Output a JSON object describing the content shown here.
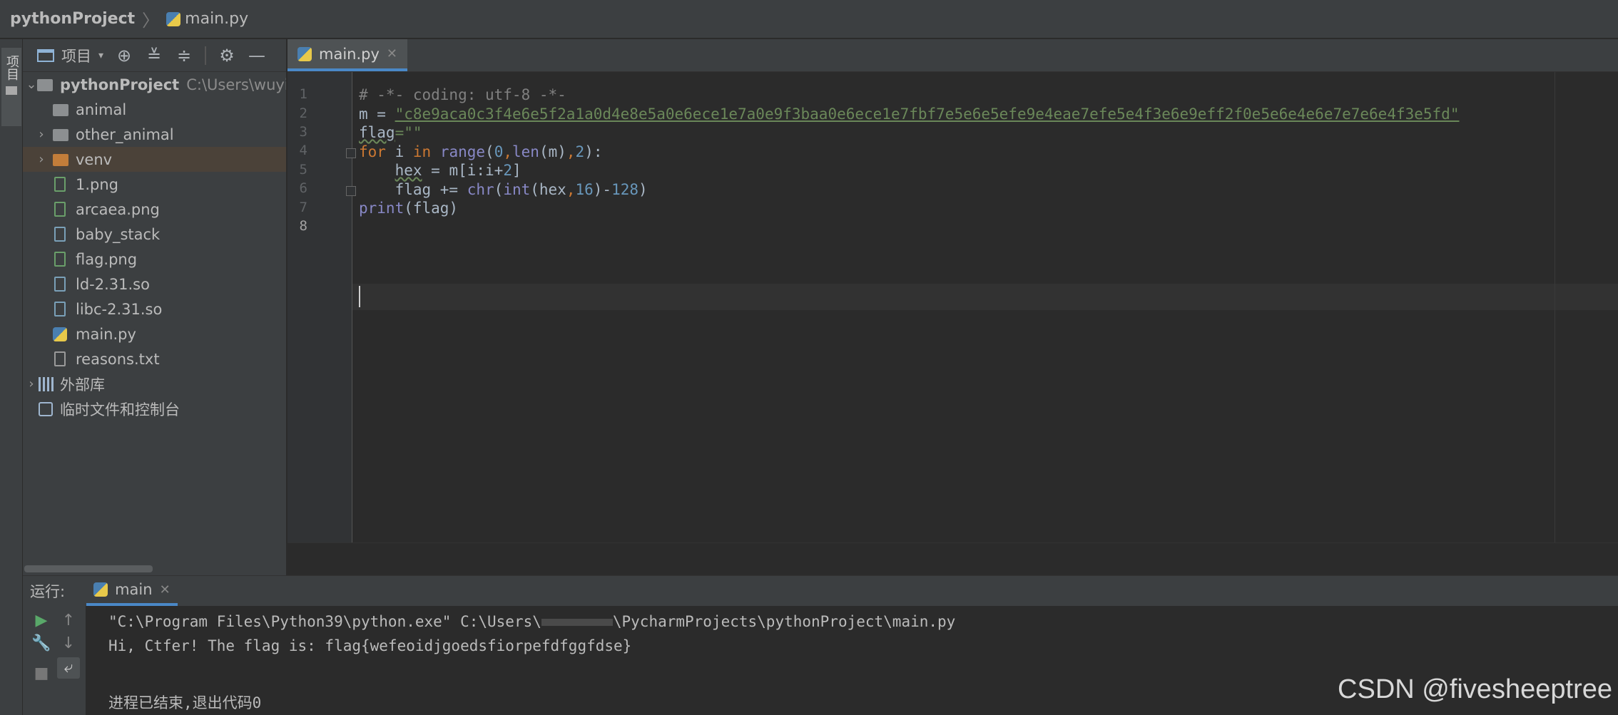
{
  "breadcrumb": {
    "project": "pythonProject",
    "file": "main.py"
  },
  "left_strip": {
    "tab_label": "项目"
  },
  "project_panel": {
    "title": "项目",
    "tree": [
      {
        "label": "pythonProject",
        "path": "C:\\Users\\wuyi",
        "kind": "project-folder",
        "expanded": true
      },
      {
        "label": "animal",
        "kind": "folder"
      },
      {
        "label": "other_animal",
        "kind": "folder",
        "collapsed": true
      },
      {
        "label": "venv",
        "kind": "folder-excluded",
        "collapsed": true,
        "selected": true
      },
      {
        "label": "1.png",
        "kind": "image"
      },
      {
        "label": "arcaea.png",
        "kind": "image"
      },
      {
        "label": "baby_stack",
        "kind": "unknown"
      },
      {
        "label": "flag.png",
        "kind": "image"
      },
      {
        "label": "ld-2.31.so",
        "kind": "unknown"
      },
      {
        "label": "libc-2.31.so",
        "kind": "unknown"
      },
      {
        "label": "main.py",
        "kind": "python"
      },
      {
        "label": "reasons.txt",
        "kind": "text"
      },
      {
        "label": "外部库",
        "kind": "library",
        "collapsed": true
      },
      {
        "label": "临时文件和控制台",
        "kind": "scratches"
      }
    ]
  },
  "editor": {
    "tab": "main.py",
    "line_numbers": [
      "1",
      "2",
      "3",
      "4",
      "5",
      "6",
      "7",
      "8"
    ],
    "lines": {
      "l1": "# -*- coding: utf-8 -*-",
      "l2_a": "m = ",
      "l2_str": "\"c8e9aca0c3f4e6e5f2a1a0d4e8e5a0e6ece1e7a0e9f3baa0e6ece1e7fbf7e5e6e5efe9e4eae7efe5e4f3e6e9eff2f0e5e6e4e6e7e7e6e4f3e5fd\"",
      "l3_a": "flag",
      "l3_b": "=\"\"",
      "l4_kw": "for",
      "l4_a": " i ",
      "l4_in": "in",
      "l4_sp": " ",
      "l4_range": "range",
      "l4_b": "(",
      "l4_0": "0",
      "l4_hint1": ",",
      "l4_len": "len",
      "l4_c": "(m)",
      "l4_hint2": ",",
      "l4_2": "2",
      "l4_d": "):",
      "l5_a": "    ",
      "l5_hex": "hex",
      "l5_b": " = m[i:i+",
      "l5_2": "2",
      "l5_c": "]",
      "l6_a": "    flag += ",
      "l6_chr": "chr",
      "l6_b": "(",
      "l6_int": "int",
      "l6_c": "(hex",
      "l6_hint": ",",
      "l6_16": "16",
      "l6_d": ")-",
      "l6_128": "128",
      "l6_e": ")",
      "l7_print": "print",
      "l7_a": "(flag)"
    }
  },
  "run_panel": {
    "label": "运行:",
    "tab": "main",
    "output": {
      "cmd_a": "\"C:\\Program Files\\Python39\\python.exe\" C:\\Users\\",
      "cmd_b": "\\PycharmProjects\\pythonProject\\main.py",
      "result": "Hi, Ctfer! The flag is: flag{wefeoidjgoedsfiorpefdfggfdse}",
      "exit": "进程已结束,退出代码0"
    }
  },
  "watermark": "CSDN @fivesheeptree",
  "colors": {
    "keyword": "#cc7832",
    "string": "#6a8759",
    "number": "#6897bb",
    "builtin": "#8888c6",
    "comment": "#808080",
    "accent": "#4a88c7"
  }
}
